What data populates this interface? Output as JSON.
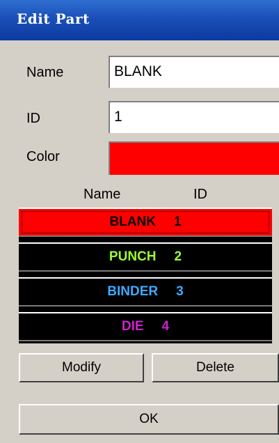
{
  "window": {
    "title": "Edit Part"
  },
  "form": {
    "name_label": "Name",
    "name_value": "BLANK",
    "id_label": "ID",
    "id_value": "1",
    "color_label": "Color",
    "color_value": "#ff0000"
  },
  "list": {
    "header_name": "Name",
    "header_id": "ID",
    "rows": [
      {
        "name": "BLANK",
        "id": "1",
        "color": "#000000",
        "background": "#ff0000",
        "selected": true
      },
      {
        "name": "PUNCH",
        "id": "2",
        "color": "#99ff33",
        "background": "#000000",
        "selected": false
      },
      {
        "name": "BINDER",
        "id": "3",
        "color": "#3fa9ff",
        "background": "#000000",
        "selected": false
      },
      {
        "name": "DIE",
        "id": "4",
        "color": "#cc22cc",
        "background": "#000000",
        "selected": false
      }
    ]
  },
  "buttons": {
    "modify": "Modify",
    "delete": "Delete",
    "ok": "OK"
  }
}
